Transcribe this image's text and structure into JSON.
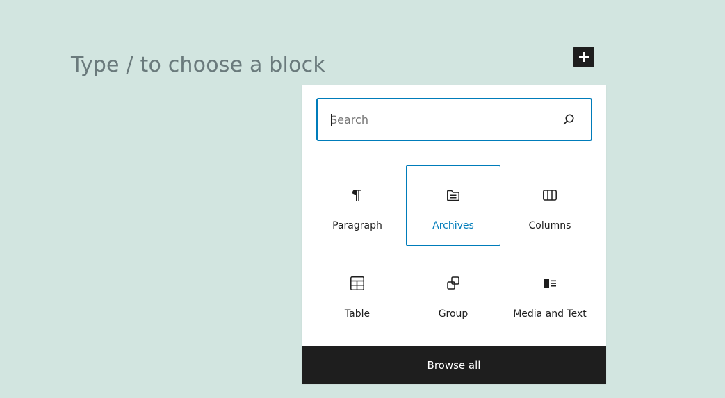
{
  "editor": {
    "placeholder": "Type / to choose a block"
  },
  "add_block_button": {
    "icon": "plus-icon"
  },
  "inserter": {
    "search": {
      "value": "",
      "placeholder": "Search",
      "icon": "search-icon"
    },
    "blocks": [
      {
        "label": "Paragraph",
        "icon": "paragraph-icon",
        "selected": false
      },
      {
        "label": "Archives",
        "icon": "archive-icon",
        "selected": true
      },
      {
        "label": "Columns",
        "icon": "columns-icon",
        "selected": false
      },
      {
        "label": "Table",
        "icon": "table-icon",
        "selected": false
      },
      {
        "label": "Group",
        "icon": "group-icon",
        "selected": false
      },
      {
        "label": "Media and Text",
        "icon": "media-text-icon",
        "selected": false
      }
    ],
    "browse_all_label": "Browse all"
  },
  "colors": {
    "background": "#d2e5e0",
    "accent": "#007cba",
    "dark": "#1e1e1e"
  }
}
